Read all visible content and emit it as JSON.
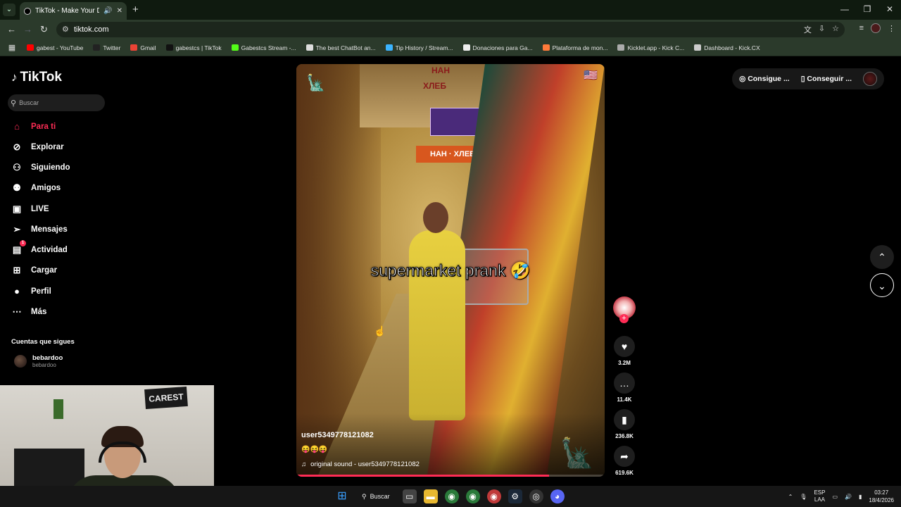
{
  "browser": {
    "tab_title": "TikTok - Make Your Day",
    "url": "tiktok.com",
    "bookmarks": [
      {
        "label": "gabest - YouTube",
        "color": "#ff0000"
      },
      {
        "label": "Twitter",
        "color": "#222222"
      },
      {
        "label": "Gmail",
        "color": "#ea4335"
      },
      {
        "label": "gabestcs | TikTok",
        "color": "#111111"
      },
      {
        "label": "Gabestcs Stream -...",
        "color": "#53fc18"
      },
      {
        "label": "The best ChatBot an...",
        "color": "#dddddd"
      },
      {
        "label": "Tip History / Stream...",
        "color": "#3bb3ff"
      },
      {
        "label": "Donaciones para Ga...",
        "color": "#eeeeee"
      },
      {
        "label": "Plataforma de mon...",
        "color": "#ff7a3a"
      },
      {
        "label": "Kicklet.app - Kick C...",
        "color": "#aaaaaa"
      },
      {
        "label": "Dashboard - Kick.CX",
        "color": "#cccccc"
      }
    ]
  },
  "tiktok": {
    "logo": "TikTok",
    "search_placeholder": "Buscar",
    "nav": [
      {
        "label": "Para ti",
        "icon": "home-icon"
      },
      {
        "label": "Explorar",
        "icon": "compass-icon"
      },
      {
        "label": "Siguiendo",
        "icon": "user-plus-icon"
      },
      {
        "label": "Amigos",
        "icon": "friends-icon"
      },
      {
        "label": "LIVE",
        "icon": "live-icon"
      },
      {
        "label": "Mensajes",
        "icon": "send-icon"
      },
      {
        "label": "Actividad",
        "icon": "inbox-icon",
        "badge": "1"
      },
      {
        "label": "Cargar",
        "icon": "upload-icon"
      },
      {
        "label": "Perfil",
        "icon": "profile-icon"
      },
      {
        "label": "Más",
        "icon": "more-icon"
      }
    ],
    "following_title": "Cuentas que sigues",
    "following": {
      "name": "bebardoo",
      "handle": "bebardoo"
    },
    "top_right": {
      "coins": "Consigue ...",
      "app": "Conseguir ..."
    },
    "video": {
      "sign_1": "НАН",
      "sign_2": "ХЛЕБ",
      "sign_3": "НАН · ХЛЕБ",
      "caption": "supermarket prank 🤣",
      "username": "user5349778121082",
      "emojis": "😝😝😝",
      "sound": "original sound - user5349778121082",
      "progress": 0.82
    },
    "actions": {
      "likes": "3.2M",
      "comments": "11.4K",
      "saves": "236.8K",
      "shares": "619.6K"
    }
  },
  "webcam": {
    "sign": "CAREST"
  },
  "taskbar": {
    "search": "Buscar",
    "lang_1": "ESP",
    "lang_2": "LAA",
    "time": "03:27",
    "date": "18/4/2026"
  }
}
